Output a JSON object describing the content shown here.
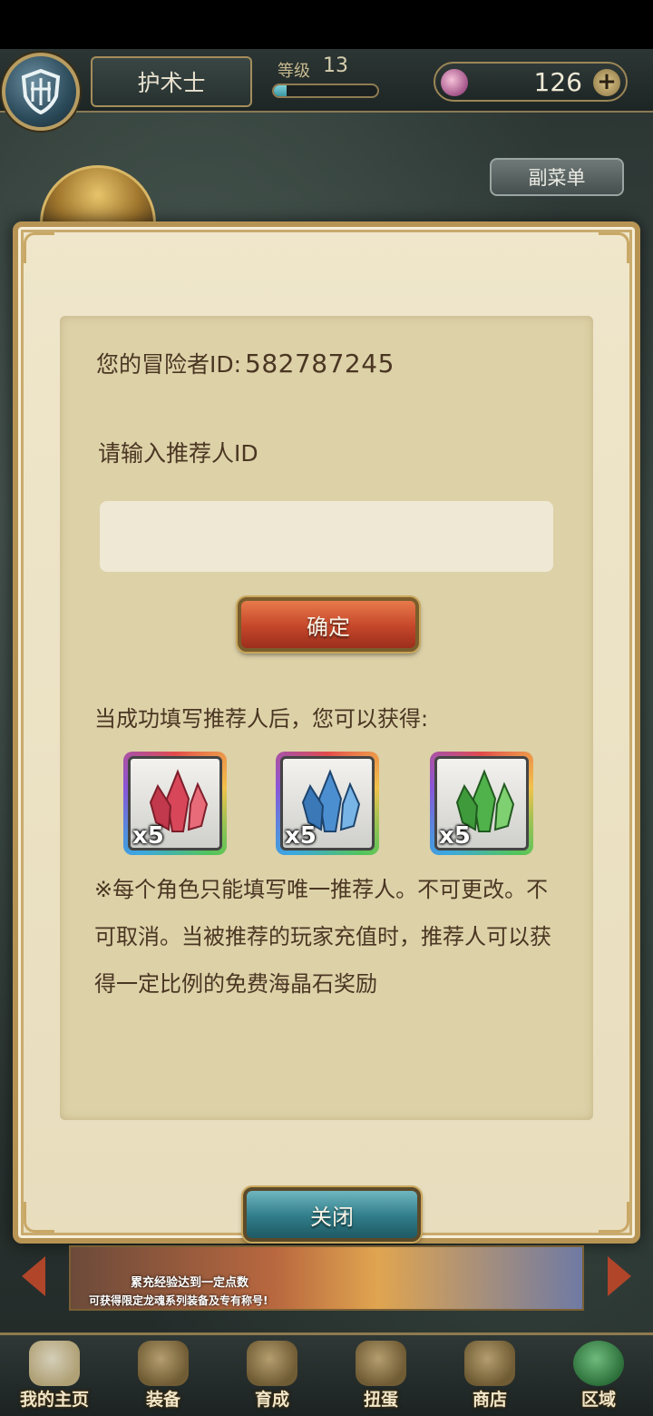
{
  "header": {
    "class_name": "护术士",
    "level_label": "等级",
    "level_value": "13",
    "level_progress": 0.12,
    "gem_count": "126",
    "gem_add": "+"
  },
  "submenu_label": "副菜单",
  "dialog": {
    "id_label": "您的冒险者ID:",
    "id_value": "582787245",
    "referrer_label": "请输入推荐人ID",
    "referrer_input_value": "",
    "confirm_label": "确定",
    "reward_intro": "当成功填写推荐人后，您可以获得:",
    "rewards": [
      {
        "icon": "red-crystal-icon",
        "color": "#d8465a",
        "quantity": "x5"
      },
      {
        "icon": "blue-crystal-icon",
        "color": "#4c8fd0",
        "quantity": "x5"
      },
      {
        "icon": "green-crystal-icon",
        "color": "#4fb24a",
        "quantity": "x5"
      }
    ],
    "note": "※每个角色只能填写唯一推荐人。不可更改。不可取消。当被推荐的玩家充值时，推荐人可以获得一定比例的免费海晶石奖励",
    "close_label": "关闭"
  },
  "banner": {
    "line1": "累充经验达到一定点数",
    "line2": "可获得限定龙魂系列装备及专有称号!"
  },
  "nav": {
    "items": [
      {
        "label": "我的主页",
        "icon": "home-scroll-icon"
      },
      {
        "label": "装备",
        "icon": "helmet-icon"
      },
      {
        "label": "育成",
        "icon": "sword-icon"
      },
      {
        "label": "扭蛋",
        "icon": "gacha-bell-icon"
      },
      {
        "label": "商店",
        "icon": "shop-bag-icon"
      },
      {
        "label": "区域",
        "icon": "globe-icon"
      }
    ]
  }
}
